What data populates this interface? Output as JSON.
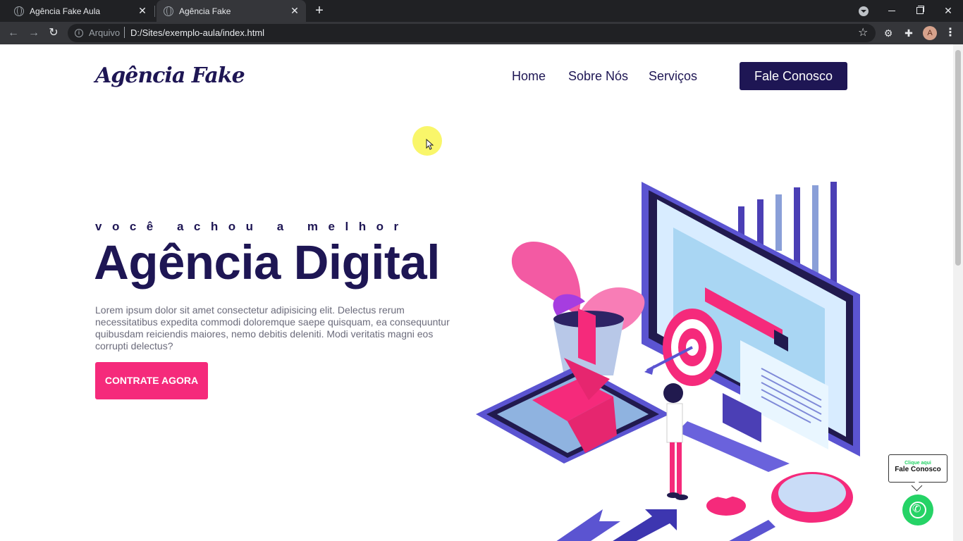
{
  "browser": {
    "tabs": [
      {
        "title": "Agência Fake Aula",
        "active": false
      },
      {
        "title": "Agência Fake",
        "active": true
      }
    ],
    "address": {
      "scheme_label": "Arquivo",
      "url": "D:/Sites/exemplo-aula/index.html"
    },
    "profile_initial": "A"
  },
  "site": {
    "logo": "Agência Fake",
    "nav": {
      "home": "Home",
      "about": "Sobre Nós",
      "services": "Serviços"
    },
    "contact_button": "Fale Conosco"
  },
  "hero": {
    "pretitle": "você achou a melhor",
    "title": "Agência Digital",
    "text": "Lorem ipsum dolor sit amet consectetur adipisicing elit. Delectus rerum necessitatibus expedita commodi doloremque saepe quisquam, ea consequuntur quibusdam reiciendis maiores, nemo debitis deleniti. Modi veritatis magni eos corrupti delectus?",
    "cta": "CONTRATE AGORA"
  },
  "whatsapp": {
    "bubble_small": "Clique aqui",
    "bubble_main": "Fale Conosco"
  },
  "colors": {
    "brand_navy": "#1e1654",
    "brand_pink": "#f52a7b",
    "whatsapp_green": "#25d366"
  }
}
